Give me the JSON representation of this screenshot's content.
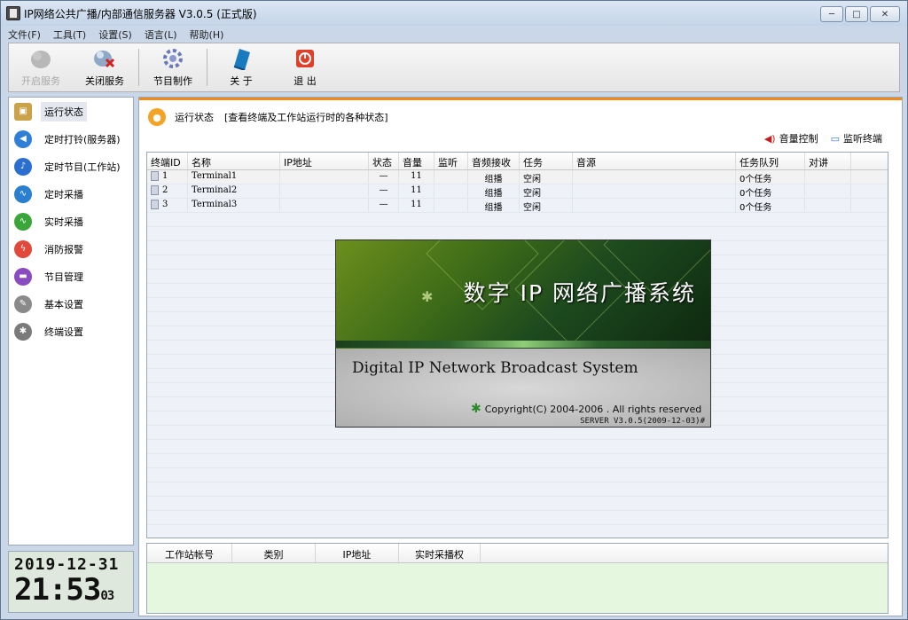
{
  "window": {
    "title": "IP网络公共广播/内部通信服务器 V3.0.5 (正式版)",
    "minimize_icon": "minimize-icon",
    "maximize_icon": "maximize-icon",
    "close_icon": "close-icon"
  },
  "menu": [
    "文件(F)",
    "工具(T)",
    "设置(S)",
    "语言(L)",
    "帮助(H)"
  ],
  "toolbar": {
    "start_label": "开启服务",
    "stop_label": "关闭服务",
    "program_label": "节目制作",
    "about_label": "关 于",
    "exit_label": "退 出"
  },
  "nav": [
    {
      "label": "运行状态",
      "icon": "monitor-icon",
      "color": "#c9a24a",
      "active": true
    },
    {
      "label": "定时打铃(服务器)",
      "icon": "speaker-icon",
      "color": "#2f7fd8"
    },
    {
      "label": "定时节目(工作站)",
      "icon": "music-note-icon",
      "color": "#2a6fd0"
    },
    {
      "label": "定时采播",
      "icon": "waveform-icon",
      "color": "#2a7fd0"
    },
    {
      "label": "实时采播",
      "icon": "pulse-icon",
      "color": "#3aa63a"
    },
    {
      "label": "消防报警",
      "icon": "alarm-icon",
      "color": "#e04a3a"
    },
    {
      "label": "节目管理",
      "icon": "folder-icon",
      "color": "#8a4ac0"
    },
    {
      "label": "基本设置",
      "icon": "wrench-icon",
      "color": "#8a8a8a"
    },
    {
      "label": "终端设置",
      "icon": "asterisk-icon",
      "color": "#7a7a7a"
    }
  ],
  "clock": {
    "date": "2019-12-31",
    "time": "21:53",
    "seconds": "03"
  },
  "header": {
    "title": "运行状态",
    "desc": "[查看终端及工作站运行时的各种状态]"
  },
  "actions": {
    "volume": "音量控制",
    "monitor": "监听终端"
  },
  "terminals": {
    "columns": [
      "终端ID",
      "名称",
      "IP地址",
      "状态",
      "音量",
      "监听",
      "音频接收",
      "任务",
      "音源",
      "任务队列",
      "对讲"
    ],
    "rows": [
      {
        "id": "1",
        "name": "Terminal1",
        "ip": "",
        "status": "—",
        "volume": "11",
        "listen": "",
        "audio": "组播",
        "task": "空闲",
        "source": "",
        "queue": "0个任务",
        "intercom": ""
      },
      {
        "id": "2",
        "name": "Terminal2",
        "ip": "",
        "status": "—",
        "volume": "11",
        "listen": "",
        "audio": "组播",
        "task": "空闲",
        "source": "",
        "queue": "0个任务",
        "intercom": ""
      },
      {
        "id": "3",
        "name": "Terminal3",
        "ip": "",
        "status": "—",
        "volume": "11",
        "listen": "",
        "audio": "组播",
        "task": "空闲",
        "source": "",
        "queue": "0个任务",
        "intercom": ""
      }
    ]
  },
  "splash": {
    "title": "数字 IP 网络广播系统",
    "subtitle": "Digital IP Network Broadcast System",
    "copyright": "Copyright(C) 2004-2006 . All rights reserved",
    "version": "SERVER V3.0.5(2009-12-03)#"
  },
  "workstations": {
    "columns": [
      "工作站帐号",
      "类别",
      "IP地址",
      "实时采播权"
    ]
  },
  "colors": {
    "accent": "#f08a1a",
    "clock_bg": "#dfe8dc",
    "bottom_bg": "#e6f7e0"
  }
}
